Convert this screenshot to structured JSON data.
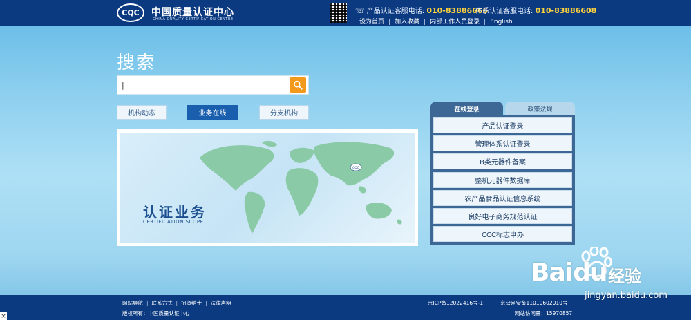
{
  "header": {
    "logo_text": "CQC",
    "brand_cn": "中国质量认证中心",
    "brand_en": "CHINA QUALITY CERTIFICATION CENTRE",
    "hotline_product_label": "产品认证客服电话:",
    "hotline_product_number": "010-83886666",
    "hotline_system_label": "体系认证客服电话:",
    "hotline_system_number": "010-83886608",
    "links": [
      "设为首页",
      "加入收藏",
      "内部工作人员登录",
      "English"
    ]
  },
  "search": {
    "title": "搜索",
    "value": "|",
    "placeholder": ""
  },
  "tabs": [
    {
      "label": "机构动态",
      "active": false
    },
    {
      "label": "业务在线",
      "active": true
    },
    {
      "label": "分支机构",
      "active": false
    }
  ],
  "banner": {
    "title": "认证业务",
    "subtitle": "CERTIFICATION SCOPE",
    "map_logo": "CQC"
  },
  "login_panel": {
    "tabs": [
      "在线登录",
      "政策法规"
    ],
    "active_tab": "在线登录",
    "buttons": [
      "产品认证登录",
      "管理体系认证登录",
      "B类元器件备案",
      "整机元器件数据库",
      "农产品食品认证信息系统",
      "良好电子商务规范认证",
      "CCC标志申办"
    ]
  },
  "footer": {
    "links": [
      "网站导航",
      "联系方式",
      "招贤纳士",
      "法律声明"
    ],
    "copyright": "版权所有：中国质量认证中心",
    "icp": "京ICP备12022416号-1",
    "police": "京公网安备11010602010号",
    "visits_label": "网站访问量：",
    "visits_value": "15970857"
  },
  "watermark": {
    "brand": "Baidu",
    "brand_cn": "经验",
    "url": "jingyan.baidu.com"
  },
  "colors": {
    "header_bg": "#0b3a80",
    "hotline_number": "#ffd23c",
    "search_button": "#f39a1d",
    "active_tab": "#1a5fae",
    "panel_bg": "#3d6895"
  }
}
